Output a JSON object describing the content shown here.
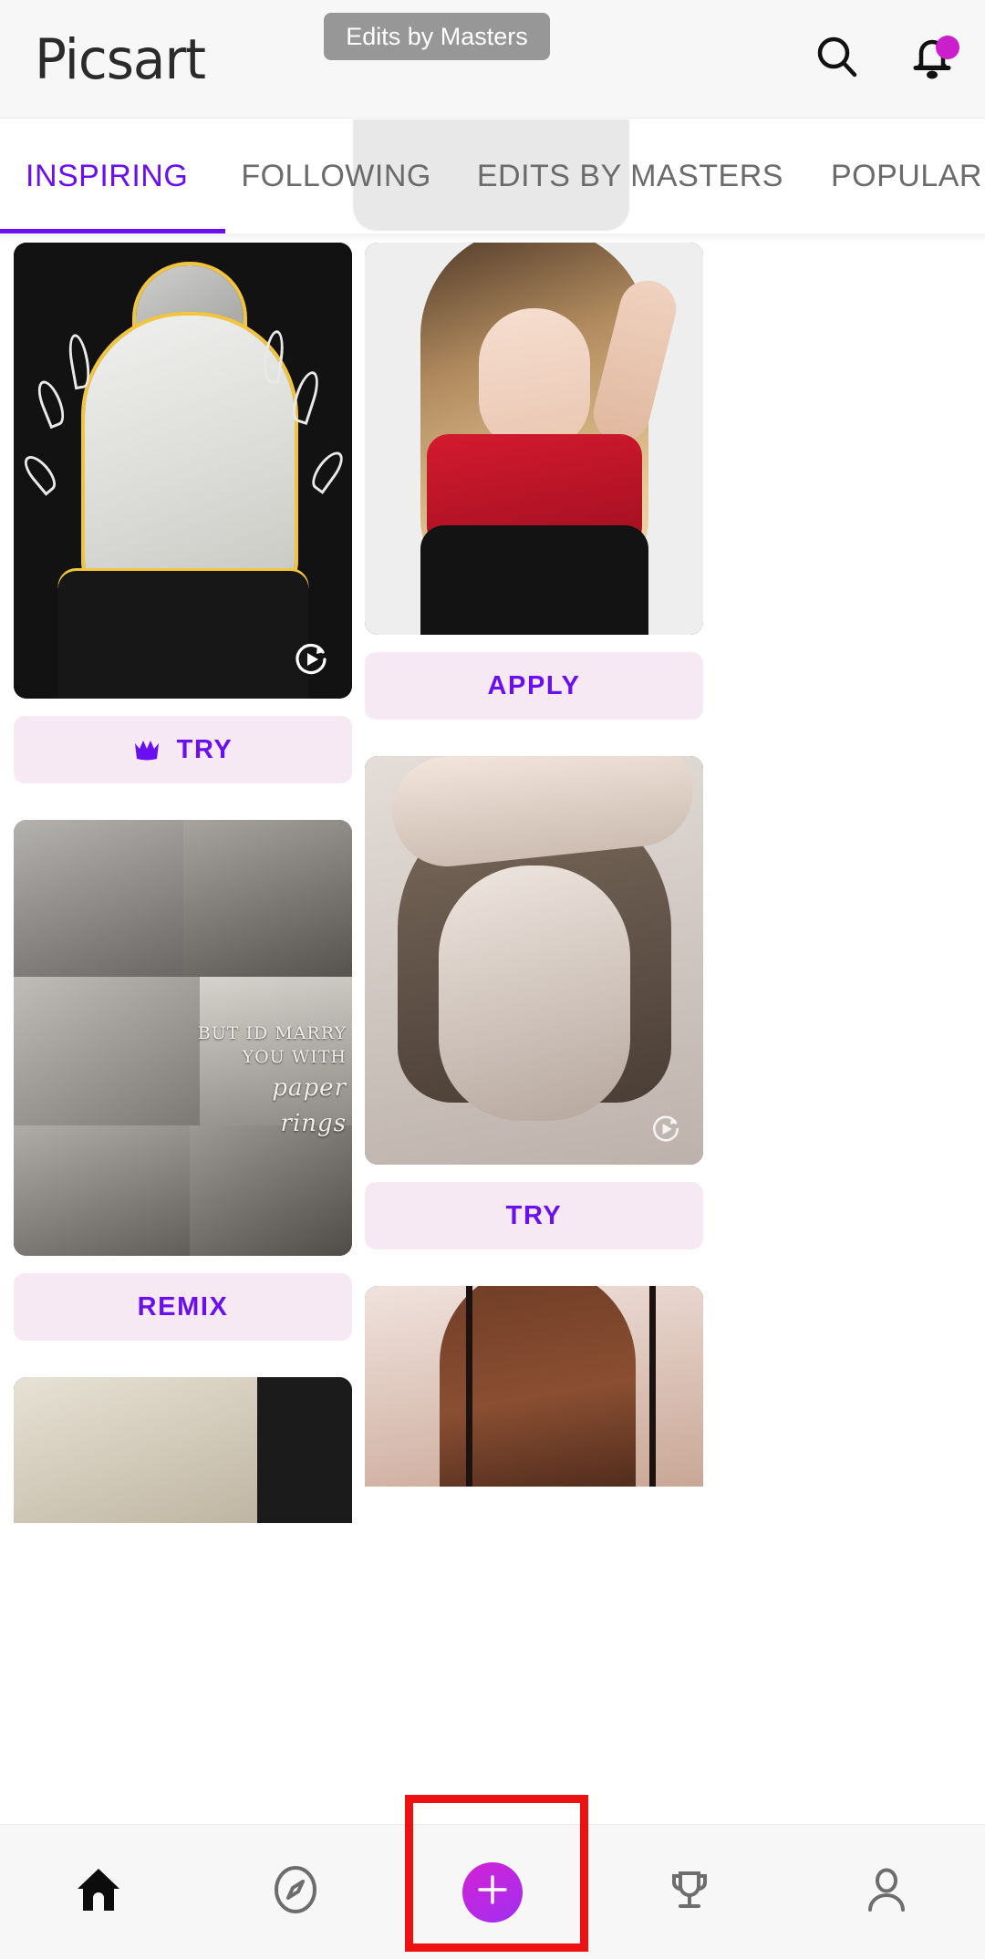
{
  "app": {
    "brand": "Picsart"
  },
  "header": {
    "pill_label": "Edits by Masters",
    "search_icon": "search-icon",
    "notifications_icon": "bell-icon",
    "notification_badge_color": "#cc1fcc"
  },
  "tabs": {
    "active_index": 0,
    "highlighted_index": 2,
    "items": [
      {
        "label": "INSPIRING"
      },
      {
        "label": "FOLLOWING"
      },
      {
        "label": "EDITS BY MASTERS"
      },
      {
        "label": "POPULAR"
      }
    ],
    "active_color": "#6a0ff0",
    "inactive_color": "#6b6b6b"
  },
  "feed": {
    "button_bg": "#f7e9f3",
    "button_text_color": "#6a0ff0",
    "cards": [
      {
        "id": "card-man-outline",
        "column": "left",
        "action_label": "TRY",
        "has_crown_icon": true,
        "has_play_badge": true,
        "play_icon": "replay-play-icon"
      },
      {
        "id": "card-girl-red-top",
        "column": "right",
        "action_label": "APPLY",
        "has_crown_icon": false,
        "has_play_badge": false
      },
      {
        "id": "card-collage-paper-rings",
        "column": "left",
        "action_label": "REMIX",
        "has_crown_icon": false,
        "has_play_badge": false,
        "overlay_text_line1": "BUT ID MARRY",
        "overlay_text_line2": "YOU WITH",
        "overlay_text_script1": "paper",
        "overlay_text_script2": "rings"
      },
      {
        "id": "card-bw-portrait",
        "column": "right",
        "action_label": "TRY",
        "has_crown_icon": false,
        "has_play_badge": true,
        "play_icon": "replay-play-icon"
      },
      {
        "id": "card-partial-bottom-left",
        "column": "left",
        "action_label": ""
      },
      {
        "id": "card-partial-bottom-right",
        "column": "right",
        "action_label": ""
      }
    ]
  },
  "bottom_nav": {
    "items": [
      {
        "name": "home",
        "icon": "home-icon",
        "active": true
      },
      {
        "name": "explore",
        "icon": "compass-icon",
        "active": false
      },
      {
        "name": "create",
        "icon": "plus-icon",
        "active": false,
        "is_fab": true
      },
      {
        "name": "challenges",
        "icon": "trophy-icon",
        "active": false
      },
      {
        "name": "profile",
        "icon": "person-icon",
        "active": false
      }
    ],
    "fab_color": "#b52ae6"
  },
  "annotation": {
    "color": "#ee1111",
    "target": "create-fab-button"
  }
}
